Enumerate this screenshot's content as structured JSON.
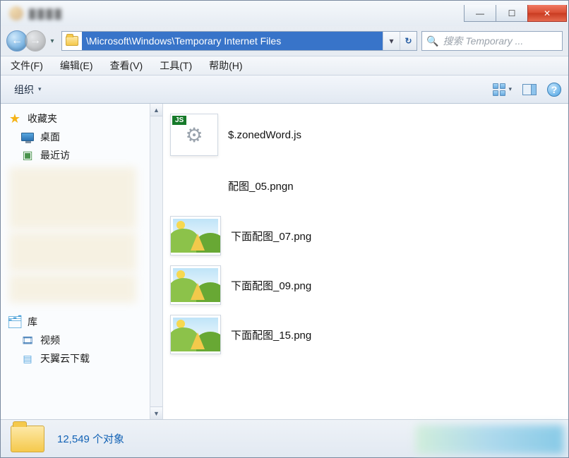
{
  "window": {
    "minimize_glyph": "—",
    "maximize_glyph": "☐",
    "close_glyph": "✕"
  },
  "nav": {
    "back_glyph": "←",
    "forward_glyph": "→",
    "history_caret": "▾",
    "address_path": "\\Microsoft\\Windows\\Temporary Internet Files",
    "dropdown_caret": "▾",
    "refresh_glyph": "↻"
  },
  "search": {
    "placeholder": "搜索 Temporary ...",
    "icon_glyph": "🔍"
  },
  "menu": {
    "file": "文件(F)",
    "edit": "编辑(E)",
    "view": "查看(V)",
    "tools": "工具(T)",
    "help": "帮助(H)"
  },
  "toolbar": {
    "organize_label": "组织",
    "organize_caret": "▾",
    "view_caret": "▾",
    "help_glyph": "?"
  },
  "sidebar": {
    "favorites_label": "收藏夹",
    "desktop_label": "桌面",
    "recent_label_truncated": "最近访",
    "libraries_label": "库",
    "videos_label": "视频",
    "cloud_label": "天翼云下载",
    "scroll_up_glyph": "▲",
    "scroll_down_glyph": "▼"
  },
  "files": [
    {
      "name": "$.zonedWord.js",
      "kind": "js"
    },
    {
      "name": "配图_05.pngn",
      "kind": "blank"
    },
    {
      "name": "下面配图_07.png",
      "kind": "image"
    },
    {
      "name": "下面配图_09.png",
      "kind": "image"
    },
    {
      "name": "下面配图_15.png",
      "kind": "image"
    }
  ],
  "status": {
    "count_text": "12,549 个对象"
  }
}
